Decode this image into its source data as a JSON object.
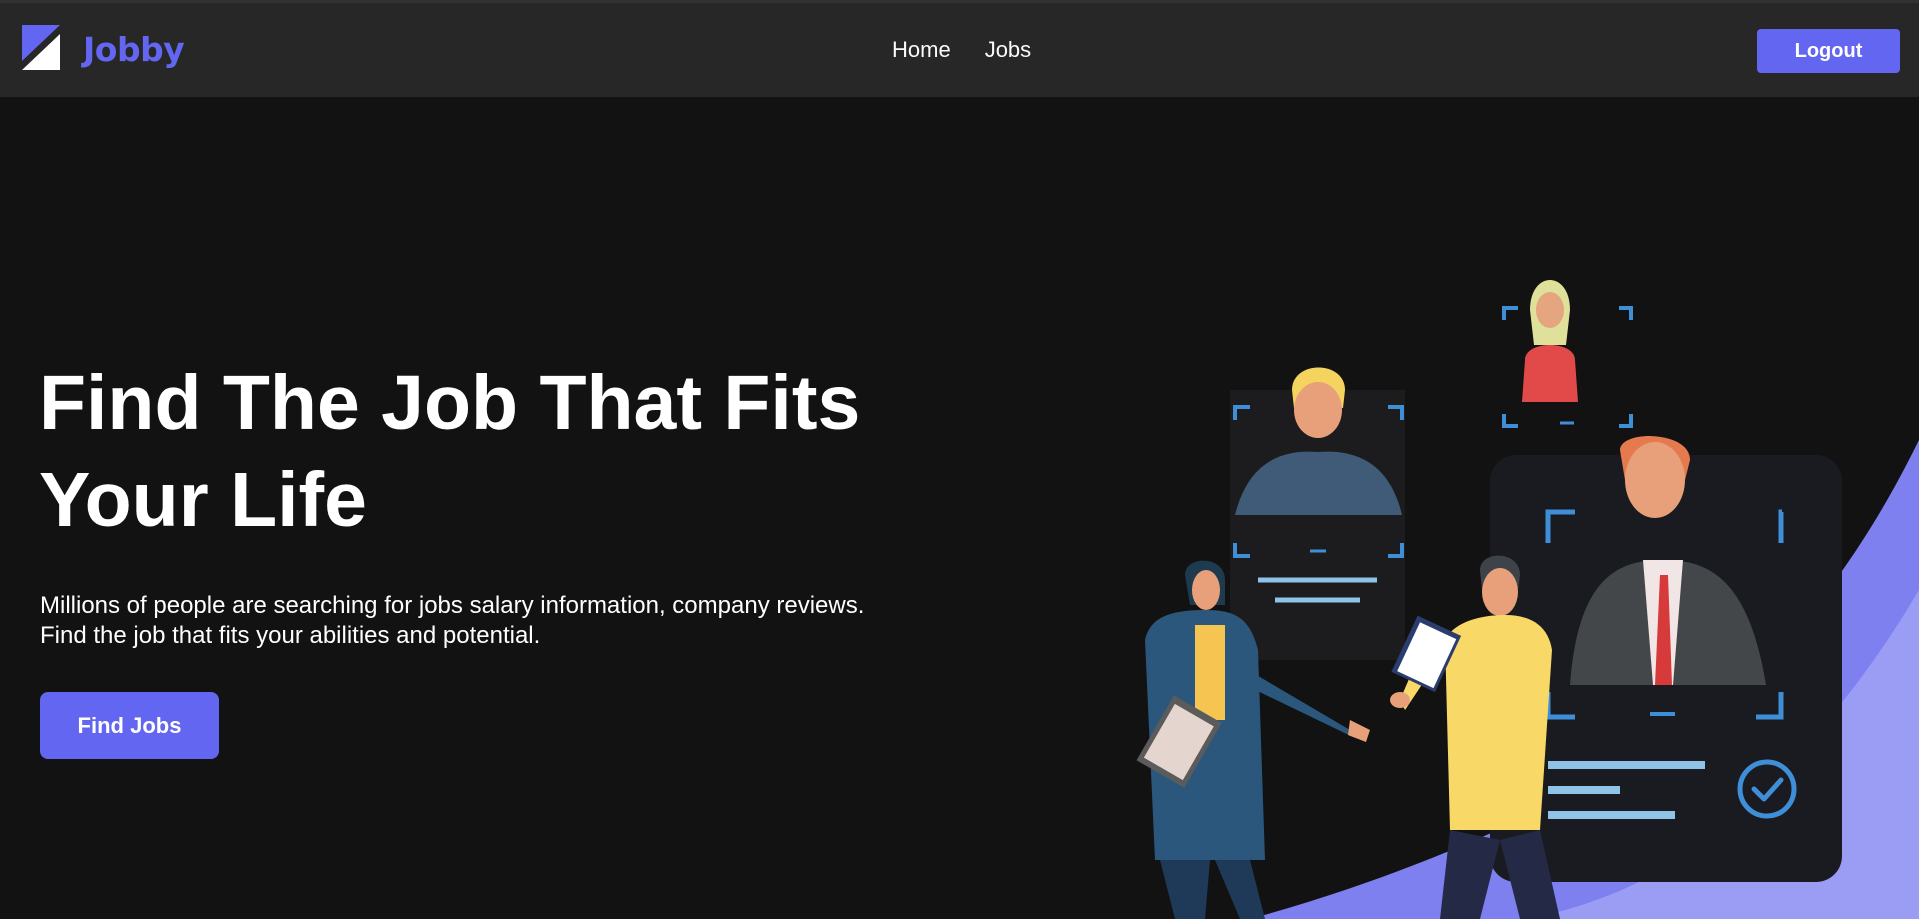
{
  "brand": {
    "name": "Jobby",
    "accent_color": "#6366f1"
  },
  "nav": {
    "links": [
      {
        "label": "Home"
      },
      {
        "label": "Jobs"
      }
    ],
    "logout_label": "Logout"
  },
  "hero": {
    "heading": "Find The Job That Fits Your Life",
    "description_lines": [
      "Millions of people are searching for jobs salary information, company reviews.",
      "Find the job that fits your abilities and potential."
    ],
    "cta_label": "Find Jobs"
  },
  "colors": {
    "page_background": "#121212",
    "navbar_background": "#272727",
    "text_primary": "#ffffff",
    "button_primary": "#6366f1"
  },
  "icons": {
    "logo": "jobby-logo-icon",
    "check": "check-circle-icon"
  }
}
